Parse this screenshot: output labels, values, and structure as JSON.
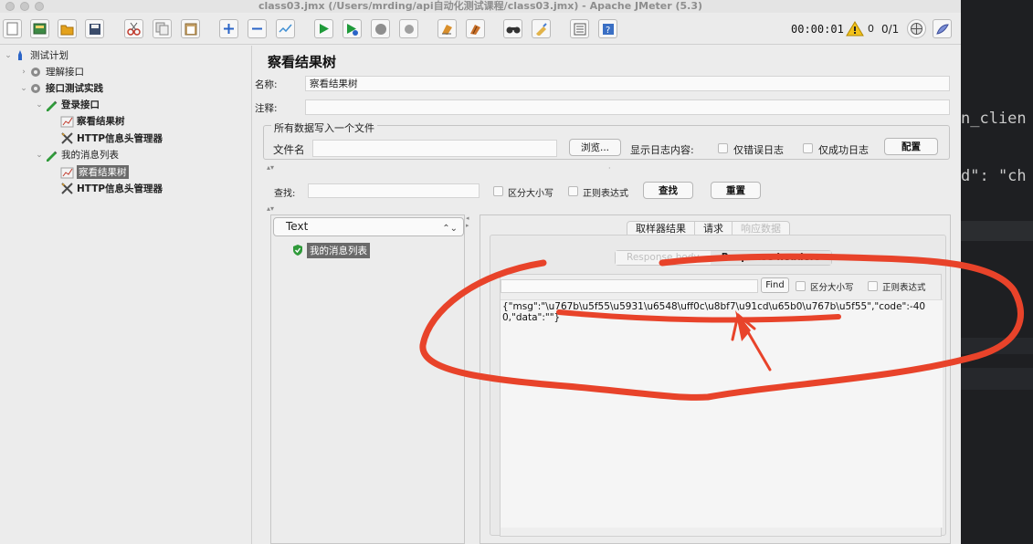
{
  "window": {
    "title": "class03.jmx (/Users/mrding/api自动化测试课程/class03.jmx) - Apache JMeter (5.3)"
  },
  "toolbar": {
    "timer": "00:00:01",
    "warning_count": "0",
    "threads": "0/1",
    "buttons": [
      "new-icon",
      "templates-icon",
      "open-icon",
      "save-icon",
      "cut-icon",
      "copy-icon",
      "paste-icon",
      "expand-icon",
      "collapse-icon",
      "toggle-icon",
      "start-icon",
      "start-no-pause-icon",
      "stop-icon",
      "shutdown-icon",
      "clear-icon",
      "clear-all-icon",
      "search-icon",
      "reset-search-icon",
      "function-helper-icon",
      "help-icon"
    ]
  },
  "tree": {
    "items": [
      {
        "label": "测试计划",
        "icon": "test-plan-icon",
        "level": 0,
        "arrow": "⌄",
        "bold": false
      },
      {
        "label": "理解接口",
        "icon": "gear-icon",
        "level": 1,
        "arrow": "›",
        "bold": false
      },
      {
        "label": "接口测试实践",
        "icon": "gear-icon",
        "level": 1,
        "arrow": "⌄",
        "bold": true
      },
      {
        "label": "登录接口",
        "icon": "pencil-icon",
        "level": 2,
        "arrow": "⌄",
        "bold": true
      },
      {
        "label": "察看结果树",
        "icon": "chart-icon",
        "level": 3,
        "arrow": "",
        "bold": true
      },
      {
        "label": "HTTP信息头管理器",
        "icon": "tools-icon",
        "level": 3,
        "arrow": "",
        "bold": true
      },
      {
        "label": "我的消息列表",
        "icon": "pencil-icon",
        "level": 2,
        "arrow": "⌄",
        "bold": false
      },
      {
        "label": "察看结果树",
        "icon": "chart-icon",
        "level": 3,
        "arrow": "",
        "bold": false,
        "selected": true
      },
      {
        "label": "HTTP信息头管理器",
        "icon": "tools-icon",
        "level": 3,
        "arrow": "",
        "bold": true
      }
    ]
  },
  "panel": {
    "title": "察看结果树",
    "name_label": "名称:",
    "name_value": "察看结果树",
    "comment_label": "注释:",
    "comment_value": "",
    "file_group": "所有数据写入一个文件",
    "filename_label": "文件名",
    "filename_value": "",
    "browse_label": "浏览...",
    "log_label": "显示日志内容:",
    "errors_only": "仅错误日志",
    "success_only": "仅成功日志",
    "config_label": "配置",
    "search_label": "查找:",
    "search_value": "",
    "case_sensitive": "区分大小写",
    "regex": "正则表达式",
    "find_label": "查找",
    "reset_label": "重置"
  },
  "results": {
    "renderer": "Text",
    "samples": [
      {
        "label": "我的消息列表",
        "status": "success"
      }
    ],
    "tabs": [
      "取样器结果",
      "请求",
      "响应数据"
    ],
    "active_tab": "响应数据",
    "subtabs": [
      "Response body",
      "Response headers"
    ],
    "active_subtab": "Response headers",
    "find_value": "",
    "find_label": "Find",
    "case_sensitive": "区分大小写",
    "regex": "正则表达式",
    "response_text": "{\"msg\":\"\\u767b\\u5f55\\u5931\\u6548\\uff0c\\u8bf7\\u91cd\\u65b0\\u767b\\u5f55\",\"code\":-400,\"data\":\"\"}"
  },
  "editor": {
    "lines": [
      "n_clien",
      "d\": \"ch"
    ]
  },
  "colors": {
    "annotation": "#e8432a",
    "window_bg": "#ececec",
    "editor_bg": "#1e1f22"
  }
}
